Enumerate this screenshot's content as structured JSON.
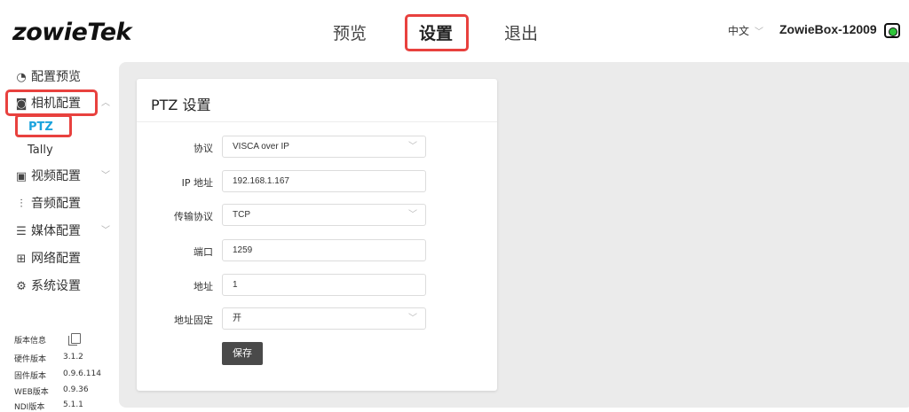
{
  "brand": {
    "logo_text": "zowieTek"
  },
  "nav": {
    "preview": "预览",
    "settings": "设置",
    "logout": "退出"
  },
  "header": {
    "language": "中文",
    "device_name": "ZowieBox-12009"
  },
  "sidebar": {
    "items": [
      {
        "label": "配置预览",
        "icon": "preview-icon"
      },
      {
        "label": "相机配置",
        "icon": "camera-icon"
      },
      {
        "label": "视频配置",
        "icon": "video-icon"
      },
      {
        "label": "音频配置",
        "icon": "audio-icon"
      },
      {
        "label": "媒体配置",
        "icon": "media-icon"
      },
      {
        "label": "网络配置",
        "icon": "network-icon"
      },
      {
        "label": "系统设置",
        "icon": "gear-icon"
      }
    ],
    "camera_sub": [
      "PTZ",
      "Tally"
    ],
    "version_info": {
      "title": "版本信息",
      "rows": [
        {
          "label": "硬件版本",
          "value": "3.1.2"
        },
        {
          "label": "固件版本",
          "value": "0.9.6.114"
        },
        {
          "label": "WEB版本",
          "value": "0.9.36"
        },
        {
          "label": "NDI版本",
          "value": "5.1.1"
        }
      ]
    }
  },
  "ptz": {
    "title": "PTZ 设置",
    "fields": [
      {
        "label": "协议",
        "value": "VISCA over IP",
        "type": "select"
      },
      {
        "label": "IP 地址",
        "value": "192.168.1.167",
        "type": "input"
      },
      {
        "label": "传输协议",
        "value": "TCP",
        "type": "select"
      },
      {
        "label": "端口",
        "value": "1259",
        "type": "input"
      },
      {
        "label": "地址",
        "value": "1",
        "type": "input"
      },
      {
        "label": "地址固定",
        "value": "开",
        "type": "select"
      }
    ],
    "save_label": "保存"
  },
  "colors": {
    "accent": "#1ba3dd",
    "highlight": "#e8413e",
    "status_green": "#2fc53a",
    "button": "#4a4a4a"
  }
}
